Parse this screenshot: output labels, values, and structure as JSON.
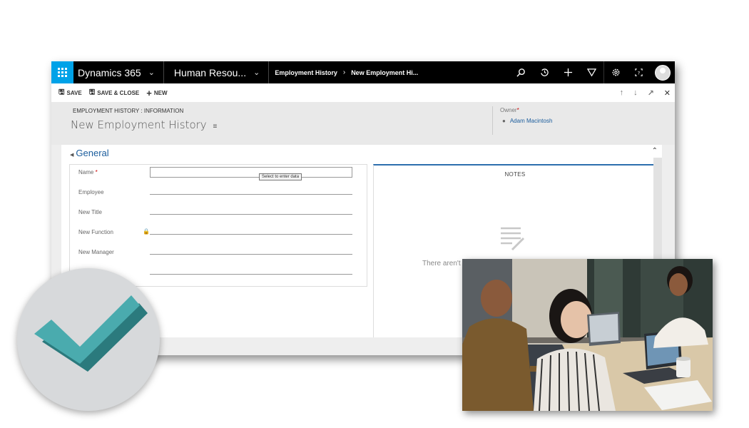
{
  "topbar": {
    "app_name": "Dynamics 365",
    "module": "Human Resou...",
    "breadcrumb": [
      "Employment History",
      "New Employment Hi..."
    ],
    "icons": [
      "search-icon",
      "history-icon",
      "plus-icon",
      "filter-icon",
      "gear-icon",
      "help-icon",
      "avatar"
    ]
  },
  "commandbar": {
    "save": "SAVE",
    "save_close": "SAVE & CLOSE",
    "new": "NEW"
  },
  "header": {
    "entity_label": "EMPLOYMENT HISTORY : INFORMATION",
    "record_title": "New Employment History",
    "owner_label": "Owner",
    "owner_value": "Adam Macintosh"
  },
  "section": {
    "title": "General",
    "fields": [
      {
        "label": "Name",
        "required": true
      },
      {
        "label": "Employee"
      },
      {
        "label": "New Title"
      },
      {
        "label": "New Function",
        "locked": true
      },
      {
        "label": "New Manager"
      }
    ],
    "tooltip": "Select to enter data"
  },
  "notes": {
    "title": "NOTES",
    "empty_text": "There aren't any"
  },
  "colors": {
    "accent": "#00a2e8",
    "link": "#1a5c9c",
    "check": "#4aabae"
  }
}
